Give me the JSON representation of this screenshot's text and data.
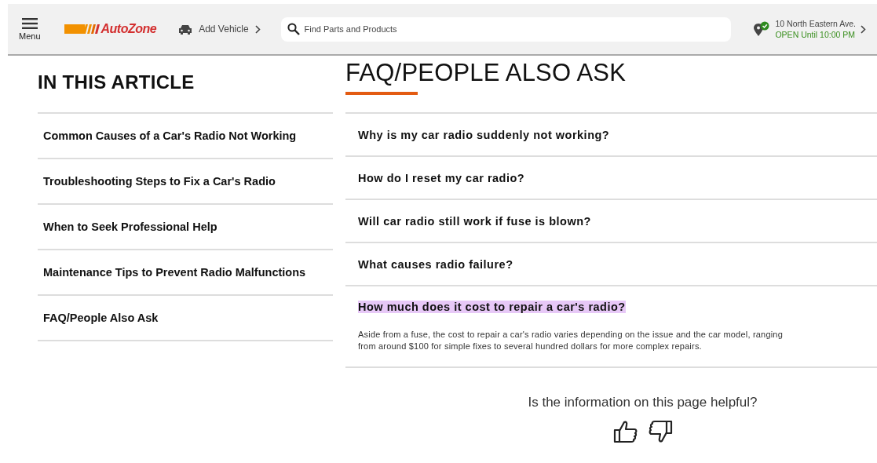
{
  "header": {
    "menu_label": "Menu",
    "logo_text": "AutoZone",
    "add_vehicle": "Add Vehicle",
    "search": {
      "placeholder": "Find Parts and Products"
    },
    "store": {
      "address": "10 North Eastern Ave.",
      "status": "OPEN Until 10:00 PM"
    }
  },
  "article_nav": {
    "title": "IN THIS ARTICLE",
    "items": [
      {
        "label": "Common Causes of a Car's Radio Not Working"
      },
      {
        "label": "Troubleshooting Steps to Fix a Car's Radio"
      },
      {
        "label": "When to Seek Professional Help"
      },
      {
        "label": "Maintenance Tips to Prevent Radio Malfunctions"
      },
      {
        "label": "FAQ/People Also Ask"
      }
    ]
  },
  "faq": {
    "title": "FAQ/PEOPLE ALSO ASK",
    "items": [
      {
        "question": "Why is my car radio suddenly not working?",
        "highlighted": false
      },
      {
        "question": "How do I reset my car radio?",
        "highlighted": false
      },
      {
        "question": "Will car radio still work if fuse is blown?",
        "highlighted": false
      },
      {
        "question": "What causes radio failure?",
        "highlighted": false
      },
      {
        "question": "How much does it cost to repair a car's radio?",
        "highlighted": true,
        "answer": "Aside from a fuse, the cost to repair a car's radio varies depending on the issue and the car model, ranging from around $100 for simple fixes to several hundred dollars for more complex repairs."
      }
    ]
  },
  "feedback": {
    "question": "Is the information on this page helpful?"
  }
}
